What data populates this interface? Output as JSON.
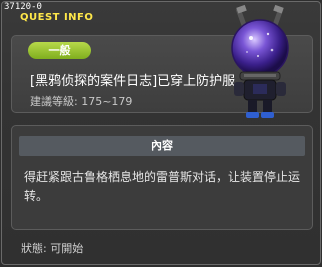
{
  "window": {
    "quest_id": "37120-0",
    "title": "QUEST INFO"
  },
  "quest": {
    "category": "一般",
    "name": "[黑鸦侦探的案件日志]已穿上防护服",
    "level_range": "建議等級: 175~179"
  },
  "content": {
    "header": "內容",
    "text": "得赶紧跟古鲁格栖息地的雷普斯对话，让装置停止运转。"
  },
  "status": {
    "text": "狀態:  可開始"
  },
  "colors": {
    "title": "#ffe84a",
    "badge": "#8fbe2a",
    "header_bar": "#555a60"
  },
  "icons": {
    "npc": "npc-diving-suit-robot-icon"
  }
}
